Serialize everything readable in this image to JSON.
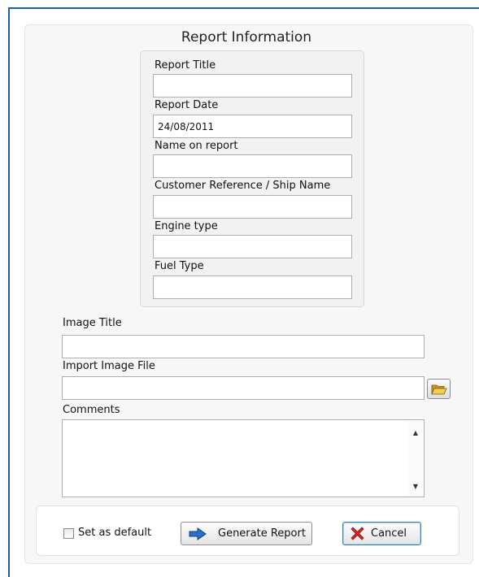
{
  "report_info": {
    "title": "Report Information",
    "fields": [
      {
        "label": "Report Title",
        "value": ""
      },
      {
        "label": "Report Date",
        "value": "24/08/2011"
      },
      {
        "label": "Name on report",
        "value": ""
      },
      {
        "label": "Customer Reference / Ship Name",
        "value": ""
      },
      {
        "label": "Engine type",
        "value": ""
      },
      {
        "label": "Fuel Type",
        "value": ""
      }
    ]
  },
  "image": {
    "title_label": "Image Title",
    "title_value": "",
    "file_label": "Import Image File",
    "file_value": "",
    "browse_icon": "folder-open-icon"
  },
  "comments": {
    "label": "Comments",
    "value": ""
  },
  "footer": {
    "set_default_label": "Set as default",
    "set_default_checked": false,
    "generate_label": "Generate Report",
    "generate_icon": "arrow-right-icon",
    "cancel_label": "Cancel",
    "cancel_icon": "red-x-icon"
  },
  "colors": {
    "accent_blue": "#1f5fa8",
    "arrow_blue": "#2a6fc9",
    "cancel_red": "#d62828",
    "folder_yellow": "#e7b93a"
  }
}
